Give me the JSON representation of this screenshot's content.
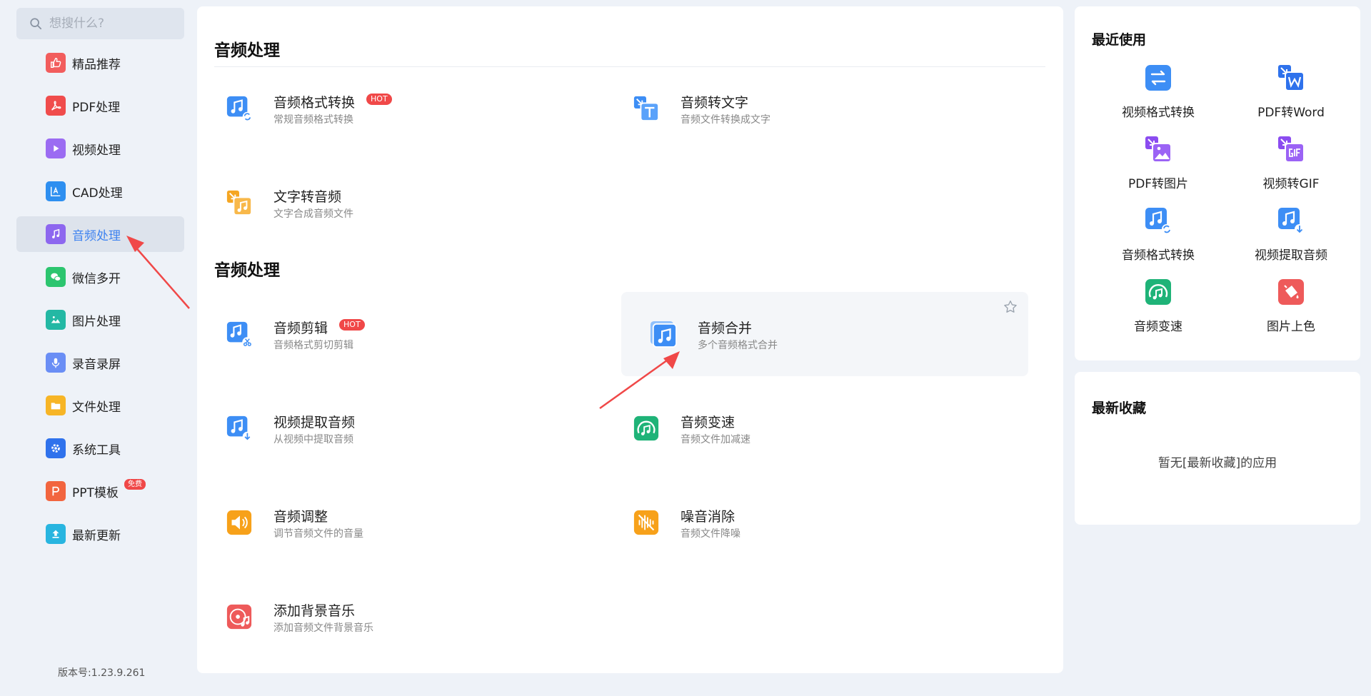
{
  "search": {
    "placeholder": "想搜什么?"
  },
  "sidebar": {
    "items": [
      {
        "label": "精品推荐",
        "icon": "thumbs-up-icon",
        "color": "#f25d5d"
      },
      {
        "label": "PDF处理",
        "icon": "pdf-icon",
        "color": "#f04c4c"
      },
      {
        "label": "视频处理",
        "icon": "video-play-icon",
        "color": "#9b6cf2"
      },
      {
        "label": "CAD处理",
        "icon": "cad-icon",
        "color": "#2e8ff0"
      },
      {
        "label": "音频处理",
        "icon": "music-note-icon",
        "color": "#8d67ef",
        "active": true
      },
      {
        "label": "微信多开",
        "icon": "wechat-icon",
        "color": "#2cc56f"
      },
      {
        "label": "图片处理",
        "icon": "image-icon",
        "color": "#23b8a4"
      },
      {
        "label": "录音录屏",
        "icon": "microphone-icon",
        "color": "#6a8ef5"
      },
      {
        "label": "文件处理",
        "icon": "folder-icon",
        "color": "#f7b526"
      },
      {
        "label": "系统工具",
        "icon": "gear-icon",
        "color": "#2f72ec"
      },
      {
        "label": "PPT模板",
        "icon": "ppt-icon",
        "color": "#f2653f",
        "badge": "免费"
      },
      {
        "label": "最新更新",
        "icon": "upload-icon",
        "color": "#28b5e0"
      }
    ],
    "version": "版本号:1.23.9.261"
  },
  "main": {
    "section1_title": "音频处理",
    "section2_title": "音频处理",
    "tools": [
      {
        "name": "音频格式转换",
        "desc": "常规音频格式转换",
        "hot": "HOT",
        "icon": "audio-convert-icon"
      },
      {
        "name": "音频转文字",
        "desc": "音频文件转换成文字",
        "icon": "audio-to-text-icon"
      },
      {
        "name": "文字转音频",
        "desc": "文字合成音频文件",
        "icon": "text-to-audio-icon"
      },
      {
        "name": "音频剪辑",
        "desc": "音频格式剪切剪辑",
        "hot": "HOT",
        "icon": "audio-cut-icon"
      },
      {
        "name": "音频合并",
        "desc": "多个音频格式合并",
        "icon": "audio-merge-icon"
      },
      {
        "name": "视频提取音频",
        "desc": "从视频中提取音频",
        "icon": "extract-audio-icon"
      },
      {
        "name": "音频变速",
        "desc": "音频文件加减速",
        "icon": "audio-speed-icon"
      },
      {
        "name": "音频调整",
        "desc": "调节音频文件的音量",
        "icon": "volume-icon"
      },
      {
        "name": "噪音消除",
        "desc": "音频文件降噪",
        "icon": "noise-reduce-icon"
      },
      {
        "name": "添加背景音乐",
        "desc": "添加音频文件背景音乐",
        "icon": "bg-music-icon"
      }
    ]
  },
  "recent": {
    "title": "最近使用",
    "items": [
      {
        "label": "视频格式转换",
        "icon": "swap-icon"
      },
      {
        "label": "PDF转Word",
        "icon": "pdf-to-word-icon"
      },
      {
        "label": "PDF转图片",
        "icon": "pdf-to-image-icon"
      },
      {
        "label": "视频转GIF",
        "icon": "video-to-gif-icon"
      },
      {
        "label": "音频格式转换",
        "icon": "audio-convert-icon"
      },
      {
        "label": "视频提取音频",
        "icon": "extract-audio-icon"
      },
      {
        "label": "音频变速",
        "icon": "audio-speed-icon"
      },
      {
        "label": "图片上色",
        "icon": "paint-bucket-icon"
      }
    ]
  },
  "favorites": {
    "title": "最新收藏",
    "empty_text": "暂无[最新收藏]的应用"
  },
  "colors": {
    "accent": "#3d82f0",
    "hot": "#f04848",
    "arrow": "#f04848"
  }
}
